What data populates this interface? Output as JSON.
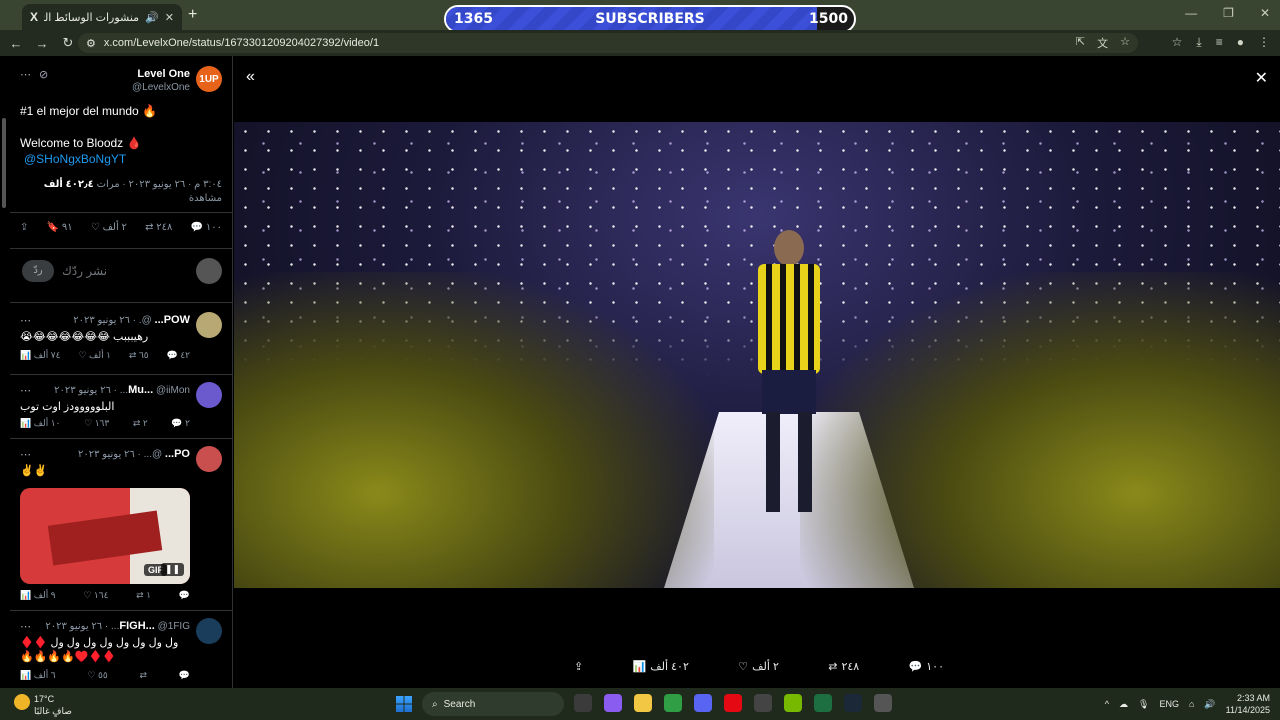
{
  "browser": {
    "tab_title": "منشورات الوسائط التي نشرها",
    "tab_logo": "X",
    "url": "x.com/LevelxOne/status/1673301209204027392/video/1"
  },
  "subscriber_widget": {
    "current": "1365",
    "label": "SUBSCRIBERS",
    "goal": "1500",
    "progress_fraction": 0.91,
    "fill_color": "#3b4fd8"
  },
  "main_tweet": {
    "name": "Level One",
    "handle": "@LevelxOne",
    "avatar_color": "#e8631a",
    "text1": "#1 el mejor del mundo 🔥",
    "text2": "Welcome to Bloodz 🩸",
    "mention": "@SHoNgxBoNgYT",
    "meta_time": "٣:٠٤ م · ٢٦ يونيو ٢٠٢٣ · مرات",
    "meta_views": "٤٠٢٫٤ ألف",
    "meta_views_label": "مشاهدة",
    "stats": {
      "replies": "١٠٠",
      "retweets": "٢٤٨",
      "likes": "٢ ألف",
      "bookmarks": "٩١"
    },
    "reply_placeholder": "نشر ردّك",
    "reply_button": "ردّ"
  },
  "replies": [
    {
      "name": "POW...",
      "meta": "@. · ٢٦ يونيو ٢٠٢٣",
      "text": "رهيبببب 😂😂😂😂😂😂😭",
      "avatar_color": "#b8a874",
      "stats": {
        "views": "٧٤ ألف",
        "likes": "١ ألف",
        "retweets": "٦٥",
        "replies": "٤٢"
      }
    },
    {
      "name": "Mu...",
      "meta": "@iiMon... · ٢٦ يونيو ٢٠٢٣",
      "text": "البلووووودز اوت توب",
      "avatar_color": "#6a5acd",
      "stats": {
        "views": "١٠ ألف",
        "likes": "١٦٣",
        "retweets": "٢",
        "replies": "٢"
      }
    },
    {
      "name": "PO...",
      "meta": "@... · ٢٦ يونيو ٢٠٢٣",
      "text": "✌️✌️",
      "avatar_color": "#c94f4f",
      "gif_label": "GIF",
      "stats": {
        "views": "٩ ألف",
        "likes": "١٦٤",
        "retweets": "١",
        "replies": ""
      }
    },
    {
      "name": "FIGH...",
      "meta": "@1FIG... · ٢٦ يونيو ٢٠٢٣",
      "text": "ول ول ول ول ول ول ول ول ♦️♦️",
      "text2": "♦️♦️♥️🔥🔥🔥🔥",
      "avatar_color": "#1a3d5c",
      "stats": {
        "views": "٦ ألف",
        "likes": "٥٥",
        "retweets": "",
        "replies": ""
      }
    }
  ],
  "viewer": {
    "stats": {
      "views": "٤٠٢ ألف",
      "likes": "٢ ألف",
      "retweets": "٢٤٨",
      "replies": "١٠٠"
    }
  },
  "taskbar": {
    "temperature": "17°C",
    "condition": "صافٍ غالبًا",
    "search_label": "Search",
    "language": "ENG",
    "time": "2:33 AM",
    "date": "11/14/2025"
  }
}
